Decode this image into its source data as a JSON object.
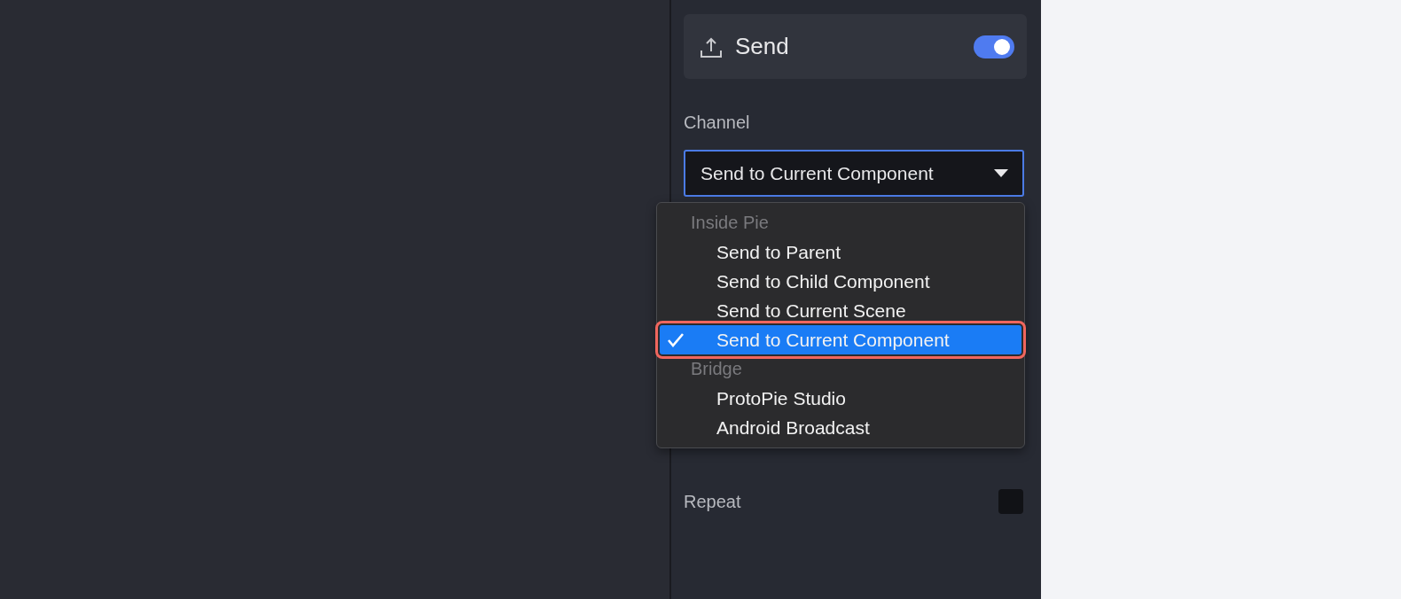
{
  "send_card": {
    "title": "Send",
    "toggle_on": true
  },
  "channel": {
    "label": "Channel",
    "value": "Send to Current Component",
    "menu": {
      "open": true,
      "groups": [
        {
          "heading": "Inside Pie",
          "items": [
            {
              "label": "Send to Parent",
              "selected": false,
              "highlighted": false
            },
            {
              "label": "Send to Child Component",
              "selected": false,
              "highlighted": false
            },
            {
              "label": "Send to Current Scene",
              "selected": false,
              "highlighted": false
            },
            {
              "label": "Send to Current Component",
              "selected": true,
              "highlighted": true
            }
          ]
        },
        {
          "heading": "Bridge",
          "items": [
            {
              "label": "ProtoPie Studio",
              "selected": false,
              "highlighted": false
            },
            {
              "label": "Android Broadcast",
              "selected": false,
              "highlighted": false
            }
          ]
        }
      ]
    }
  },
  "repeat": {
    "label": "Repeat",
    "checked": false
  }
}
